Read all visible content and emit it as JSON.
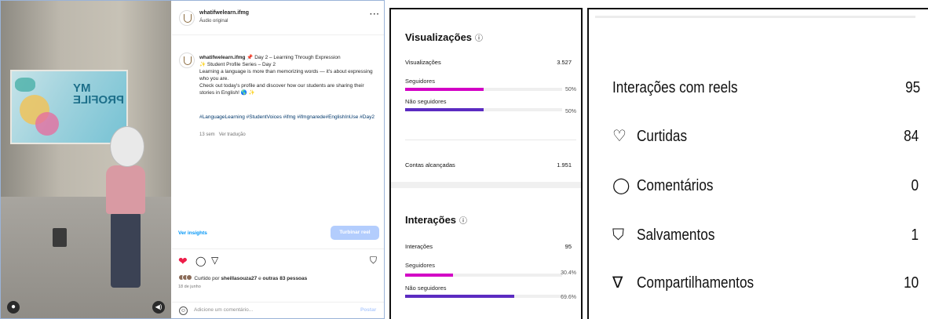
{
  "post": {
    "username": "whatifwelearn.ifmg",
    "audio": "Áudio original",
    "more": "···",
    "caption_title": "📌 Day 2 – Learning Through Expression",
    "caption_line2": "✨ Student Profile Series – Day 2",
    "caption_body": "Learning a language is more than memorizing words — it's about expressing who you are.",
    "caption_cta": "Check out today's profile and discover how our students are sharing their stories in English! 🌎 ✨",
    "hashtags": "#LanguageLearning #StudentVoices #ifmg #ifmgnarede#EnglishInUse #Day2",
    "time_ago": "13 sem",
    "translate": "Ver tradução",
    "insights_link": "Ver insights",
    "boost_button": "Turbinar reel",
    "liked_prefix": "Curtido por",
    "liked_user": "sheillasouza27",
    "liked_mid": "e",
    "liked_others": "outras 83 pessoas",
    "date": "18 de junho",
    "comment_placeholder": "Adicione um comentário...",
    "post_button": "Postar",
    "slide_title": "MY PROFILE",
    "icons": {
      "heart": "heart-filled-icon",
      "comment": "comment-icon",
      "share": "share-icon",
      "save": "bookmark-icon",
      "emoji": "emoji-icon",
      "user": "user-icon",
      "mute": "mute-icon"
    },
    "colors": {
      "like": "#ed1d49",
      "link": "#0095f6",
      "boost": "#b3cdfd"
    }
  },
  "insights": {
    "views_title": "Visualizações",
    "info_icon": "ⓘ",
    "views_label": "Visualizações",
    "views_value": "3.527",
    "views_breakdown": [
      {
        "label": "Seguidores",
        "pct_text": "50%",
        "pct": 50,
        "color": "#d300c5"
      },
      {
        "label": "Não seguidores",
        "pct_text": "50%",
        "pct": 50,
        "color": "#5b2bc1"
      }
    ],
    "reached_label": "Contas alcançadas",
    "reached_value": "1.951",
    "interactions_title": "Interações",
    "interactions_label": "Interações",
    "interactions_value": "95",
    "interactions_breakdown": [
      {
        "label": "Seguidores",
        "pct_text": "30.4%",
        "pct": 30.4,
        "color": "#d300c5"
      },
      {
        "label": "Não seguidores",
        "pct_text": "69.6%",
        "pct": 69.6,
        "color": "#5b2bc1"
      }
    ]
  },
  "reels": {
    "title": "Interações com reels",
    "total": "95",
    "rows": [
      {
        "icon": "heart-outline-icon",
        "glyph": "♡",
        "label": "Curtidas",
        "value": "84"
      },
      {
        "icon": "comment-icon",
        "glyph": "◯",
        "label": "Comentários",
        "value": "0"
      },
      {
        "icon": "bookmark-icon",
        "glyph": "⛉",
        "label": "Salvamentos",
        "value": "1"
      },
      {
        "icon": "share-icon",
        "glyph": "∇",
        "label": "Compartilhamentos",
        "value": "10"
      }
    ]
  }
}
